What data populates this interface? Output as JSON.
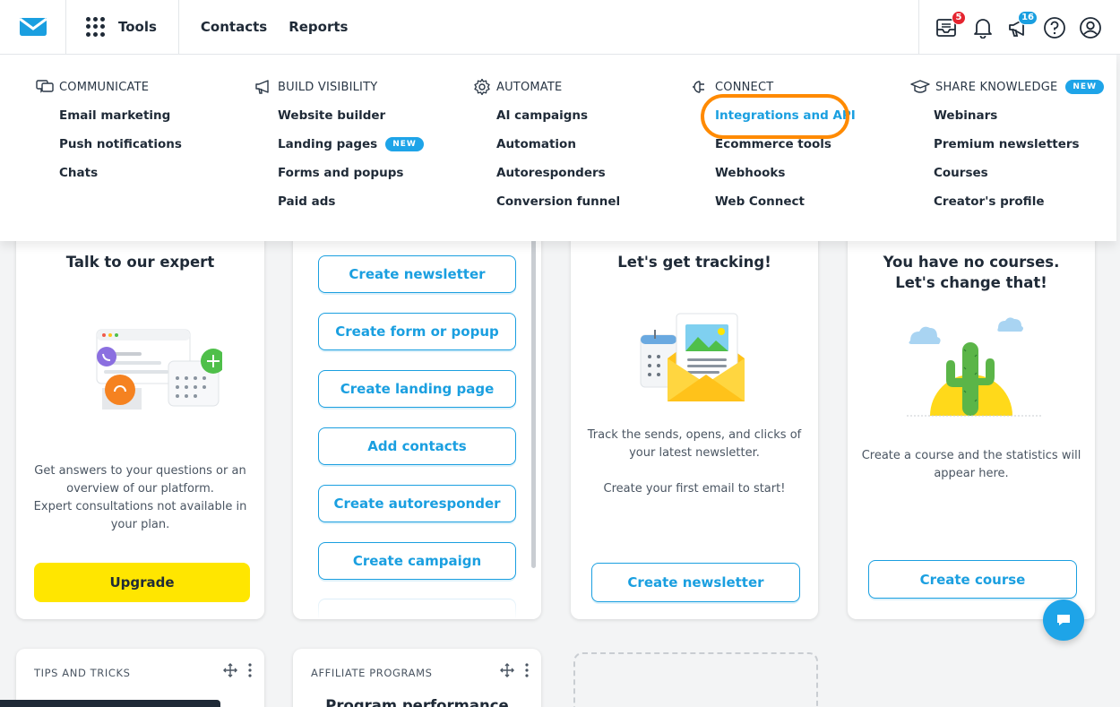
{
  "nav": {
    "tools_label": "Tools",
    "contacts_label": "Contacts",
    "reports_label": "Reports",
    "inbox_badge": "5",
    "announcements_badge": "16",
    "colors": {
      "accent": "#1a9fe0",
      "badge_red": "#e5242f",
      "highlight": "#ff8a00",
      "upgrade": "#ffe600"
    }
  },
  "menu": {
    "communicate": {
      "title": "COMMUNICATE",
      "items": [
        "Email marketing",
        "Push notifications",
        "Chats"
      ]
    },
    "build_visibility": {
      "title": "BUILD VISIBILITY",
      "items": [
        "Website builder",
        "Landing pages",
        "Forms and popups",
        "Paid ads"
      ],
      "new_label": "NEW"
    },
    "automate": {
      "title": "AUTOMATE",
      "items": [
        "AI campaigns",
        "Automation",
        "Autoresponders",
        "Conversion funnel"
      ]
    },
    "connect": {
      "title": "CONNECT",
      "items": [
        "Integrations and API",
        "Ecommerce tools",
        "Webhooks",
        "Web Connect"
      ]
    },
    "share_knowledge": {
      "title": "SHARE KNOWLEDGE",
      "new_label": "NEW",
      "items": [
        "Webinars",
        "Premium newsletters",
        "Courses",
        "Creator's profile"
      ]
    }
  },
  "expert_card": {
    "title": "Talk to our expert",
    "text_1": "Get answers to your questions or an",
    "text_2": "overview of our platform.",
    "text_3": "Expert consultations not available in",
    "text_4": "your plan.",
    "button": "Upgrade"
  },
  "quick_actions": {
    "buttons": [
      "Create newsletter",
      "Create form or popup",
      "Create landing page",
      "Add contacts",
      "Create autoresponder",
      "Create campaign"
    ]
  },
  "tracking_card": {
    "title": "Let's get tracking!",
    "text_1": "Track the sends, opens, and clicks of",
    "text_2": "your latest newsletter.",
    "text_3": "Create your first email to start!",
    "button": "Create newsletter"
  },
  "courses_card": {
    "title_1": "You have no courses.",
    "title_2": "Let's change that!",
    "text_1": "Create a course and the statistics will",
    "text_2": "appear here.",
    "button": "Create course"
  },
  "widgets": {
    "tips_label": "TIPS AND TRICKS",
    "affiliate_label": "AFFILIATE PROGRAMS",
    "affiliate_title": "Program performance"
  }
}
